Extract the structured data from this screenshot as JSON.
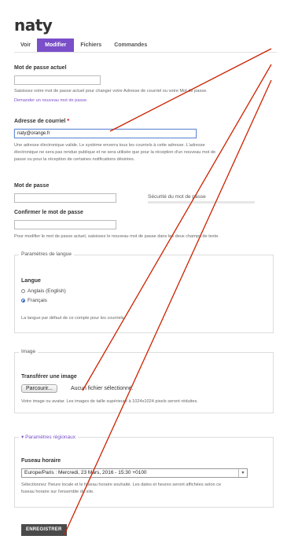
{
  "page": {
    "title": "naty"
  },
  "tabs": [
    "Voir",
    "Modifier",
    "Fichiers",
    "Commandes"
  ],
  "active_tab": "Modifier",
  "current_password": {
    "label": "Mot de passe actuel",
    "value": "",
    "description": "Saisissez votre mot de passe actuel pour changer votre Adresse de courriel ou votre Mot de passe.",
    "link": "Demander un nouveau mot de passe."
  },
  "email": {
    "label": "Adresse de courriel",
    "required_mark": "*",
    "value": "naty@orange.fr",
    "description_lines": [
      "Une adresse électronique valide. Le système enverra tous les courriels à cette adresse. L'adresse",
      "électronique ne sera pas rendue publique et ne sera utilisée que pour la réception d'un nouveau mot de",
      "passe ou pour la réception de certaines notifications désirées."
    ]
  },
  "password": {
    "label": "Mot de passe",
    "value": "",
    "strength_label": "Sécurité du mot de passe"
  },
  "confirm_password": {
    "label": "Confirmer le mot de passe",
    "value": "",
    "description": "Pour modifier le mot de passe actuel, saisissez le nouveau mot de passe dans les deux champs de texte."
  },
  "language": {
    "legend": "Paramètres de langue",
    "label": "Langue",
    "options": [
      "Anglais (English)",
      "Français"
    ],
    "selected": "Français",
    "description": "La langue par défaut de ce compte pour les courriels."
  },
  "image": {
    "legend": "Image",
    "label": "Transférer une image",
    "browse_label": "Parcourir...",
    "no_file": "Aucun fichier sélectionné.",
    "description": "Votre image ou avatar. Les images de taille supérieure à 1024x1024 pixels seront réduites."
  },
  "regional": {
    "legend_arrow": "▾",
    "legend": "Paramètres régionaux",
    "label": "Fuseau horaire",
    "selected_value": "Europe/Paris : Mercredi, 23 Mars, 2016 - 15:30 +0100",
    "description_lines": [
      "Sélectionnez l'heure locale et le fuseau horaire souhaité. Les dates et heures seront affichées selon ce",
      "fuseau horaire sur l'ensemble du site."
    ]
  },
  "save_label": "ENREGISTRER",
  "colors": {
    "accent": "#7a4fc9",
    "annotation_lines": "#cc2200",
    "button_dark": "#4a4a4a",
    "required": "#cc0000"
  }
}
